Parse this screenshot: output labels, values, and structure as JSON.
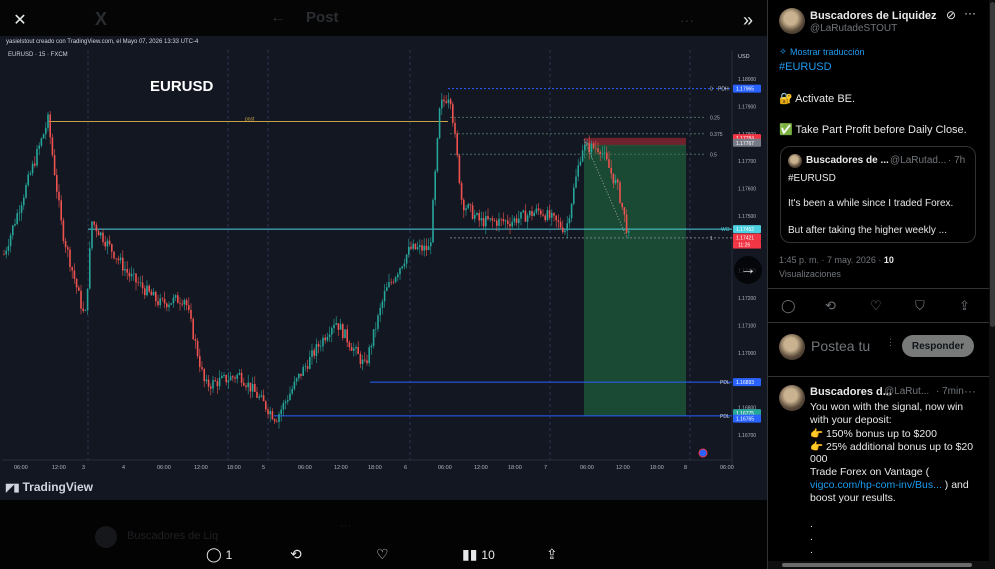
{
  "ghost": {
    "logo": "X",
    "back": "←",
    "title": "Post",
    "more": "···",
    "reply_hint": "Buscadores de Liq",
    "ghost_reply": "···"
  },
  "viewer": {
    "close": "✕",
    "expand": "»",
    "next": "→",
    "actions": {
      "reply_count": "1",
      "retweet_count": "",
      "like_count": "",
      "views_count": "10"
    }
  },
  "chart_image": {
    "author_line": "yasielstout creado con TradingView.com, el Mayo 07, 2026 13:33 UTC-4",
    "symbol": "EURUSD · 15 · FXCM",
    "title": "EURUSD",
    "branding": "TradingView",
    "currency": "USD",
    "level_labels": {
      "pdh": "PDH",
      "wo": "WO",
      "pdl1": "PDL",
      "pdl2": "PDL",
      "post": "post",
      "fib0": "0",
      "fib025": "0.25",
      "fib0375": "0.375",
      "fib05": "0.5",
      "fib1": "1"
    },
    "badges": {
      "pdh": "1.17965",
      "red1": "1.17784",
      "red2": "1.17767",
      "wo": "1.17452",
      "red3": "1.17421",
      "red3_sub": "11:26",
      "pdl1": "1.16893",
      "pdl2a": "1.16775",
      "pdl2b": "1.16765"
    },
    "y_ticks": [
      "1.18000",
      "1.17900",
      "1.17800",
      "1.17700",
      "1.17600",
      "1.17500",
      "1.17400",
      "1.17300",
      "1.17200",
      "1.17100",
      "1.17000",
      "1.16900",
      "1.16800",
      "1.16700"
    ],
    "x_ticks": [
      "06:00",
      "12:00",
      "3",
      "4",
      "06:00",
      "12:00",
      "18:00",
      "5",
      "06:00",
      "12:00",
      "18:00",
      "6",
      "06:00",
      "12:00",
      "18:00",
      "7",
      "06:00",
      "12:00",
      "18:00",
      "8",
      "06:00"
    ],
    "colors": {
      "bg": "#131722",
      "up": "#26a69a",
      "down": "#ef5350",
      "level": "#2962ff",
      "cyan": "#4dd0e1",
      "post": "#c8a048",
      "zone_target": "#1e5c3a",
      "zone_stop": "#7a2230"
    }
  },
  "post": {
    "author_name": "Buscadores de Liquidez",
    "author_handle": "@LaRutadeSTOUT",
    "translate": "Mostrar traducción",
    "hashtag": "#EURUSD",
    "line_be": "🔐 Activate BE.",
    "line_tp": "✅ Take Part Profit before Daily Close.",
    "quote": {
      "name": "Buscadores de ...",
      "handle": "@LaRutad...",
      "time": "· 7h",
      "hashtag": "#EURUSD",
      "line1": "It's been a while since I traded Forex.",
      "line2": "But after taking the higher weekly ..."
    },
    "meta_time": "1:45 p. m. · 7 may. 2026 · ",
    "meta_views": "10",
    "meta_views_label": "Visualizaciones",
    "icons": {
      "reply": "💬",
      "retweet": "⟲",
      "like": "♡",
      "bookmark": "🔖",
      "share": "⇪",
      "grok": "⊘",
      "more": "···"
    },
    "reply_placeholder": "Postea tu",
    "reply_button": "Responder"
  },
  "reply": {
    "name": "Buscadores d...",
    "handle": "@LaRut...",
    "time": "· 7min",
    "more": "···",
    "lines": [
      "You won with the signal, now win",
      "with your deposit:",
      "👉 150% bonus up to $200",
      "👉 25% additional bonus up to $20",
      "000",
      "Trade Forex on Vantage (",
      "vigco.com/hp-com-inv/Bus... ) and",
      "boost your results.",
      ".",
      ".",
      "."
    ],
    "link": "vigco.com/hp-com-inv/Bus..."
  }
}
